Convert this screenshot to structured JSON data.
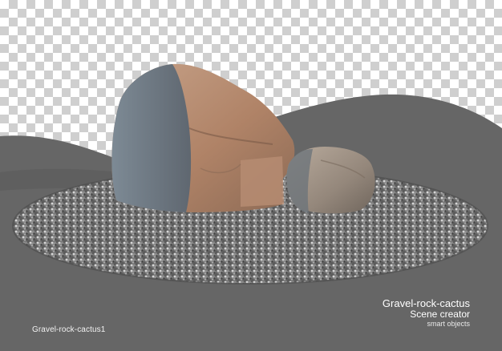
{
  "scene": {
    "caption_left": "Gravel-rock-cactus1",
    "caption_title": "Gravel-rock-cactus",
    "caption_subtitle": "Scene creator",
    "caption_note": "smart objects"
  },
  "colors": {
    "backdrop": "#666666",
    "checker_light": "#ffffff",
    "checker_dark": "#cfcfcf",
    "rock": "#a8826a",
    "gravel": "#8c8c8c",
    "caption_text": "#ffffff"
  }
}
